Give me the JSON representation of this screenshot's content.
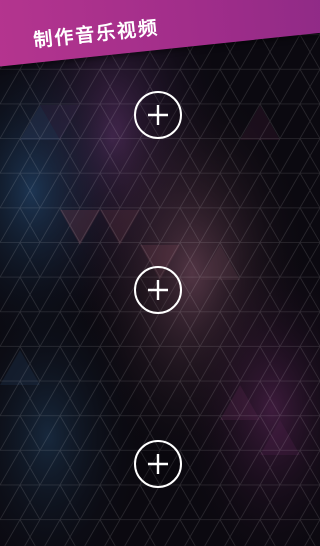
{
  "header": {
    "title": "制作音乐视频"
  },
  "slots": [
    {
      "action": "add",
      "icon": "plus-icon"
    },
    {
      "action": "add",
      "icon": "plus-icon"
    },
    {
      "action": "add",
      "icon": "plus-icon"
    }
  ],
  "colors": {
    "banner": "#b5358f",
    "background": "#0a0810",
    "button_outline": "#ffffff"
  }
}
